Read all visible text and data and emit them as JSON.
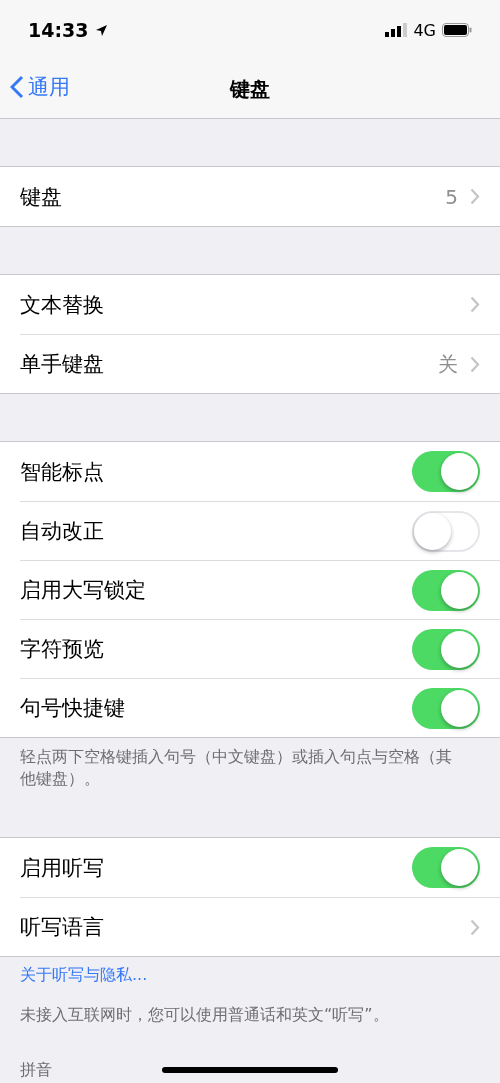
{
  "status_bar": {
    "time": "14:33",
    "network": "4G"
  },
  "nav": {
    "back": "通用",
    "title": "键盘"
  },
  "groups": [
    {
      "rows": [
        {
          "kind": "disclosure",
          "label": "键盘",
          "value": "5"
        }
      ]
    },
    {
      "rows": [
        {
          "kind": "disclosure",
          "label": "文本替换"
        },
        {
          "kind": "disclosure",
          "label": "单手键盘",
          "value": "关"
        }
      ]
    },
    {
      "rows": [
        {
          "kind": "toggle",
          "label": "智能标点",
          "on": true
        },
        {
          "kind": "toggle",
          "label": "自动改正",
          "on": false
        },
        {
          "kind": "toggle",
          "label": "启用大写锁定",
          "on": true
        },
        {
          "kind": "toggle",
          "label": "字符预览",
          "on": true
        },
        {
          "kind": "toggle",
          "label": "句号快捷键",
          "on": true
        }
      ],
      "footer": [
        {
          "kind": "note",
          "text": "轻点两下空格键插入句号（中文键盘）或插入句点与空格（其他键盘）。"
        }
      ]
    },
    {
      "rows": [
        {
          "kind": "toggle",
          "label": "启用听写",
          "on": true
        },
        {
          "kind": "disclosure",
          "label": "听写语言"
        }
      ],
      "footer": [
        {
          "kind": "link",
          "text": "关于听写与隐私..."
        },
        {
          "kind": "note",
          "text": "未接入互联网时，您可以使用普通话和英文“听写”。"
        }
      ]
    }
  ],
  "section_header": "拼音"
}
